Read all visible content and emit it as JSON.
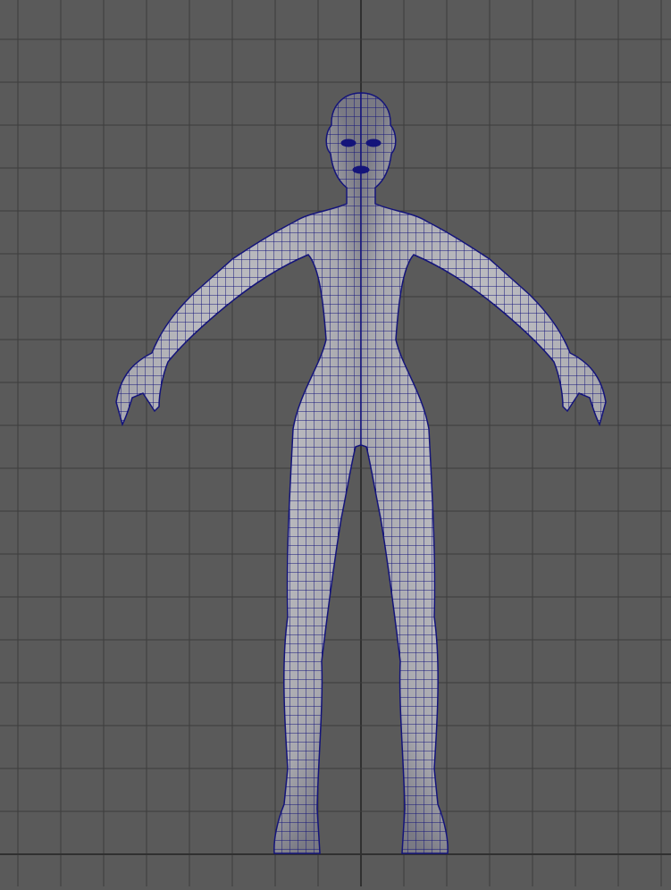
{
  "viewport": {
    "view": "front-orthographic",
    "display_mode": "wireframe-on-shaded",
    "colors": {
      "background": "#5a5a5a",
      "grid_line": "#3c3c3c",
      "grid_axis": "#303030",
      "mesh_fill": "#b4b4b8",
      "wireframe": "#14147a"
    }
  }
}
